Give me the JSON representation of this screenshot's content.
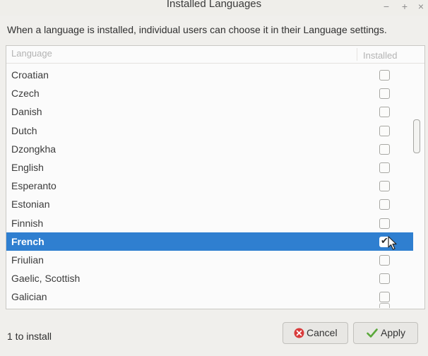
{
  "window": {
    "title": "Installed Languages",
    "controls": {
      "minimize": "−",
      "maximize": "+",
      "close": "×"
    }
  },
  "description": "When a language is installed, individual users can choose it in their Language settings.",
  "list": {
    "columns": {
      "language": "Language",
      "installed": "Installed"
    },
    "rows": [
      {
        "name": "Croatian",
        "installed": false,
        "selected": false
      },
      {
        "name": "Czech",
        "installed": false,
        "selected": false
      },
      {
        "name": "Danish",
        "installed": false,
        "selected": false
      },
      {
        "name": "Dutch",
        "installed": false,
        "selected": false
      },
      {
        "name": "Dzongkha",
        "installed": false,
        "selected": false
      },
      {
        "name": "English",
        "installed": false,
        "selected": false
      },
      {
        "name": "Esperanto",
        "installed": false,
        "selected": false
      },
      {
        "name": "Estonian",
        "installed": false,
        "selected": false
      },
      {
        "name": "Finnish",
        "installed": false,
        "selected": false
      },
      {
        "name": "French",
        "installed": true,
        "selected": true
      },
      {
        "name": "Friulian",
        "installed": false,
        "selected": false
      },
      {
        "name": "Gaelic, Scottish",
        "installed": false,
        "selected": false
      },
      {
        "name": "Galician",
        "installed": false,
        "selected": false
      }
    ]
  },
  "footer": {
    "status": "1 to install",
    "cancel_label": "Cancel",
    "apply_label": "Apply"
  },
  "colors": {
    "selection": "#2f7fd0",
    "cancel_icon": "#d93b3b",
    "apply_icon": "#5aa83a"
  },
  "icons": {
    "cancel": "cancel-circle-icon",
    "apply": "checkmark-icon",
    "pointer": "mouse-pointer-icon"
  }
}
